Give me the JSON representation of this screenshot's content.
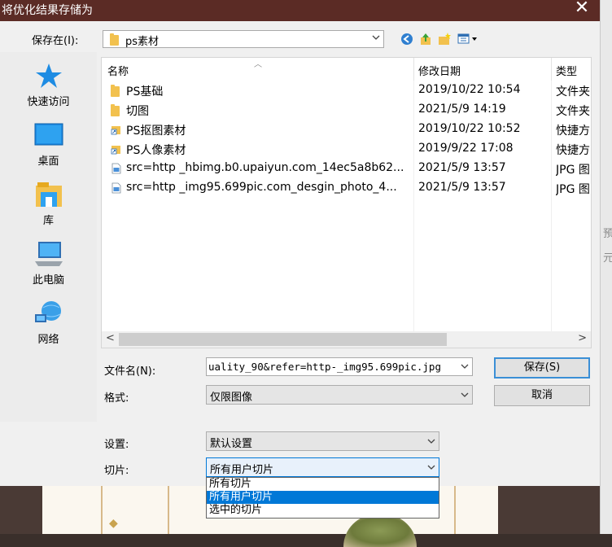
{
  "dialog": {
    "title": "将优化结果存储为",
    "close_glyph": "✕"
  },
  "save_in": {
    "label": "保存在(I):",
    "value": "ps素材"
  },
  "places": [
    {
      "label": "快速访问",
      "icon": "star-icon"
    },
    {
      "label": "桌面",
      "icon": "desktop-icon"
    },
    {
      "label": "库",
      "icon": "library-icon"
    },
    {
      "label": "此电脑",
      "icon": "computer-icon"
    },
    {
      "label": "网络",
      "icon": "network-icon"
    }
  ],
  "filelist": {
    "columns": [
      "名称",
      "修改日期",
      "类型"
    ],
    "rows": [
      {
        "name": "PS基础",
        "date": "2019/10/22 10:54",
        "type": "文件夹",
        "icon": "folder-icon"
      },
      {
        "name": "切图",
        "date": "2021/5/9 14:19",
        "type": "文件夹",
        "icon": "folder-icon"
      },
      {
        "name": "PS抠图素材",
        "date": "2019/10/22 10:52",
        "type": "快捷方",
        "icon": "shortcut-folder-icon"
      },
      {
        "name": "PS人像素材",
        "date": "2019/9/22 17:08",
        "type": "快捷方",
        "icon": "shortcut-folder-icon"
      },
      {
        "name": "src=http _hbimg.b0.upaiyun.com_14ec5a8b62...",
        "date": "2021/5/9 13:57",
        "type": "JPG 图",
        "icon": "image-file-icon"
      },
      {
        "name": "src=http _img95.699pic.com_desgin_photo_4...",
        "date": "2021/5/9 13:57",
        "type": "JPG 图",
        "icon": "image-file-icon"
      }
    ]
  },
  "filename": {
    "label": "文件名(N):",
    "value": "uality_90&refer=http-_img95.699pic.jpg"
  },
  "format": {
    "label": "格式:",
    "value": "仅限图像"
  },
  "settings": {
    "label": "设置:",
    "value": "默认设置"
  },
  "slices": {
    "label": "切片:",
    "value": "所有用户切片",
    "options": [
      "所有切片",
      "所有用户切片",
      "选中的切片"
    ],
    "selected_index": 1
  },
  "buttons": {
    "save": "保存(S)",
    "cancel": "取消"
  },
  "background": {
    "hint1": "預",
    "hint2": "元"
  },
  "colors": {
    "titlebar": "#5b2b25",
    "selection": "#0078d7",
    "default_button_border": "#3b8fd6"
  }
}
